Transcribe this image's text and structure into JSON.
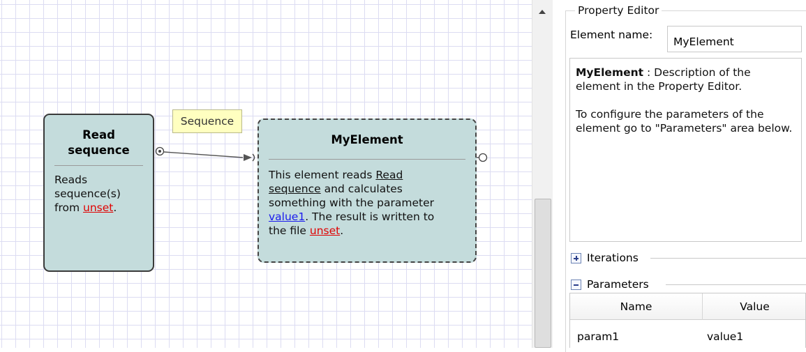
{
  "canvas": {
    "read_element": {
      "title_line1": "Read",
      "title_line2": "sequence",
      "desc_line1": "Reads",
      "desc_line2": "sequence(s)",
      "desc_prefix": "from ",
      "desc_link": "unset",
      "desc_suffix": "."
    },
    "connection_label": "Sequence",
    "my_element": {
      "title": "MyElement",
      "desc_line1": "This element reads ",
      "desc_link1a": "Read",
      "desc_link1b": "sequence",
      "desc_line2_rest": " and calculates",
      "desc_line3": "something with the parameter",
      "desc_value_link": "value1",
      "desc_line4_rest": ". The result is written to",
      "desc_line5_prefix": "the file ",
      "desc_file_link": "unset",
      "desc_line5_suffix": "."
    }
  },
  "property_editor": {
    "title": "Property Editor",
    "element_name_label": "Element name:",
    "element_name_value": "MyElement",
    "description": {
      "name": "MyElement",
      "line1_rest": " : Description of the element in the Property Editor.",
      "para2": "To configure the parameters of the element go to \"Parameters\" area below."
    },
    "sections": {
      "iterations": "Iterations",
      "parameters": "Parameters"
    },
    "table": {
      "columns": [
        "Name",
        "Value"
      ],
      "rows": [
        {
          "name": "param1",
          "value": "value1"
        }
      ]
    }
  },
  "icons": {
    "scroll_up": "arrow-up-icon",
    "iterations_toggle": "expand-plus-icon",
    "parameters_toggle": "collapse-minus-icon",
    "out_port": "output-port-icon",
    "in_port": "input-port-icon"
  }
}
